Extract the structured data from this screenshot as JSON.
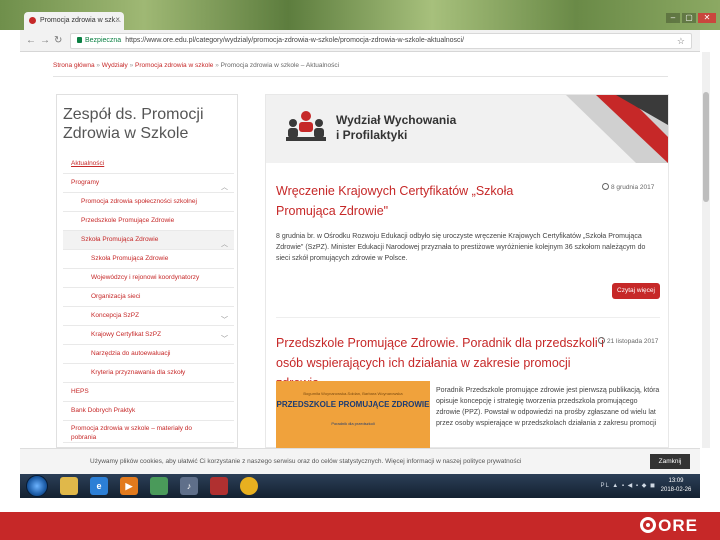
{
  "browser": {
    "tab_title": "Promocja zdrowia w szk...",
    "tab_close": "×",
    "window_controls": [
      "–",
      "▢",
      "✕"
    ],
    "secure_label": "Bezpieczna",
    "url": "https://www.ore.edu.pl/category/wydzialy/promocja-zdrowia-w-szkole/promocja-zdrowia-w-szkole-aktualnosci/"
  },
  "breadcrumb": [
    "Strona główna",
    "Wydziały",
    "Promocja zdrowia w szkole",
    "Promocja zdrowia w szkole – Aktualności"
  ],
  "sidebar": {
    "title": "Zespół ds. Promocji Zdrowia w Szkole",
    "items": [
      {
        "label": "Aktualności",
        "level": 1,
        "active": true
      },
      {
        "label": "Programy",
        "level": 1,
        "chevron": "up"
      },
      {
        "label": "Promocja zdrowia społeczności szkolnej",
        "level": 2
      },
      {
        "label": "Przedszkole Promujące Zdrowie",
        "level": 2
      },
      {
        "label": "Szkoła Promująca Zdrowie",
        "level": 2,
        "chevron": "up",
        "open": true
      },
      {
        "label": "Szkoła Promująca Zdrowie",
        "level": 3
      },
      {
        "label": "Wojewódzcy i rejonowi koordynatorzy",
        "level": 3
      },
      {
        "label": "Organizacja sieci",
        "level": 3
      },
      {
        "label": "Koncepcja SzPZ",
        "level": 3,
        "chevron": "down"
      },
      {
        "label": "Krajowy Certyfikat SzPZ",
        "level": 3,
        "chevron": "down"
      },
      {
        "label": "Narzędzia do autoewaluacji",
        "level": 3
      },
      {
        "label": "Kryteria przyznawania dla szkoły",
        "level": 3
      },
      {
        "label": "HEPS",
        "level": 1
      },
      {
        "label": "Bank Dobrych Praktyk",
        "level": 1
      },
      {
        "label": "Promocja zdrowia w szkole – materiały do pobrania",
        "level": 1
      }
    ]
  },
  "banner": {
    "line1": "Wydział Wychowania",
    "line2": "i Profilaktyki",
    "colors": {
      "dark": "#3a3a3a",
      "red": "#c62828",
      "gray": "#d0d0d0"
    }
  },
  "posts": [
    {
      "title": "Wręczenie Krajowych Certyfikatów „Szkoła Promująca Zdrowie\"",
      "date": "8 grudnia 2017",
      "body": "8 grudnia br. w Ośrodku Rozwoju Edukacji odbyło się uroczyste wręczenie Krajowych Certyfikatów „Szkoła Promująca Zdrowie\" (SzPZ). Minister Edukacji Narodowej przyznała to prestiżowe wyróżnienie kolejnym 36 szkołom należącym do sieci szkół promujących zdrowie w Polsce.",
      "more": "Czytaj więcej"
    },
    {
      "title": "Przedszkole Promujące Zdrowie. Poradnik dla przedszkoli i osób wspierających ich działania w zakresie promocji zdrowia",
      "date": "21 listopada 2017",
      "image_authors": "Bogumiła Woynarowska-Sołdan, Barbara Woynarowska",
      "image_title": "PRZEDSZKOLE PROMUJĄCE ZDROWIE",
      "image_subtitle": "Poradnik dla przedszkoli",
      "body": "Poradnik Przedszkole promujące zdrowie jest pierwszą publikacją, która opisuje koncepcję i strategię tworzenia przedszkola promującego zdrowie (PPZ). Powstał w odpowiedzi na prośby zgłaszane od wielu lat przez osoby wspierające w przedszkolach działania z zakresu promocji"
    }
  ],
  "cookie": {
    "text": "Używamy plików cookies, aby ułatwić Ci korzystanie z naszego serwisu oraz do celów statystycznych. Więcej informacji w naszej polityce prywatności",
    "close": "Zamknij"
  },
  "taskbar": {
    "clock_time": "13:09",
    "clock_date": "2018-02-26",
    "tray": "PL ▲ ▪ ◀ ▪ ◆ ◼",
    "apps": [
      {
        "name": "folder",
        "color": "#e0b84a"
      },
      {
        "name": "ie",
        "color": "#2c7fd6"
      },
      {
        "name": "media",
        "color": "#e27a1d"
      },
      {
        "name": "network",
        "color": "#4a9a5a"
      },
      {
        "name": "itunes",
        "color": "#5f6f8a"
      },
      {
        "name": "pdf",
        "color": "#b03030"
      },
      {
        "name": "chrome",
        "color": "#e8b020"
      }
    ]
  },
  "brand": {
    "logo_text": "ORE",
    "color": "#c62828"
  }
}
